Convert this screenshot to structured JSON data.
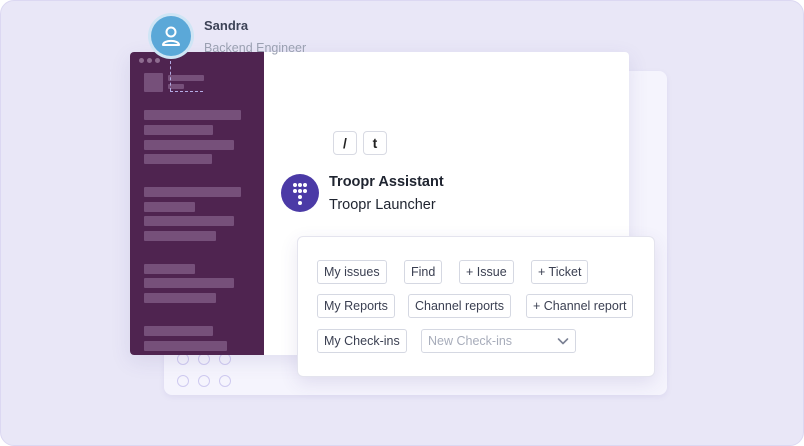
{
  "user": {
    "name": "Sandra",
    "role": "Backend Engineer"
  },
  "shortcut_keys": [
    "/",
    "t"
  ],
  "bot": {
    "name": "Troopr Assistant",
    "subtitle": "Troopr Launcher"
  },
  "launcher": {
    "row1": [
      "My issues",
      "Find",
      "+ Issue",
      "+ Ticket"
    ],
    "row2": [
      "My Reports",
      "Channel reports",
      "+ Channel report"
    ],
    "row3_button": "My Check-ins",
    "checkin_select": "New Check-ins"
  },
  "colors": {
    "background": "#e9e7f7",
    "sidebar": "#4f2450",
    "user_avatar": "#5ba8d8",
    "bot_avatar": "#4b3aa6"
  },
  "icons": {
    "user_avatar": "person-icon",
    "bot_avatar": "troopr-logo-icon",
    "select_caret": "chevron-down-icon"
  }
}
